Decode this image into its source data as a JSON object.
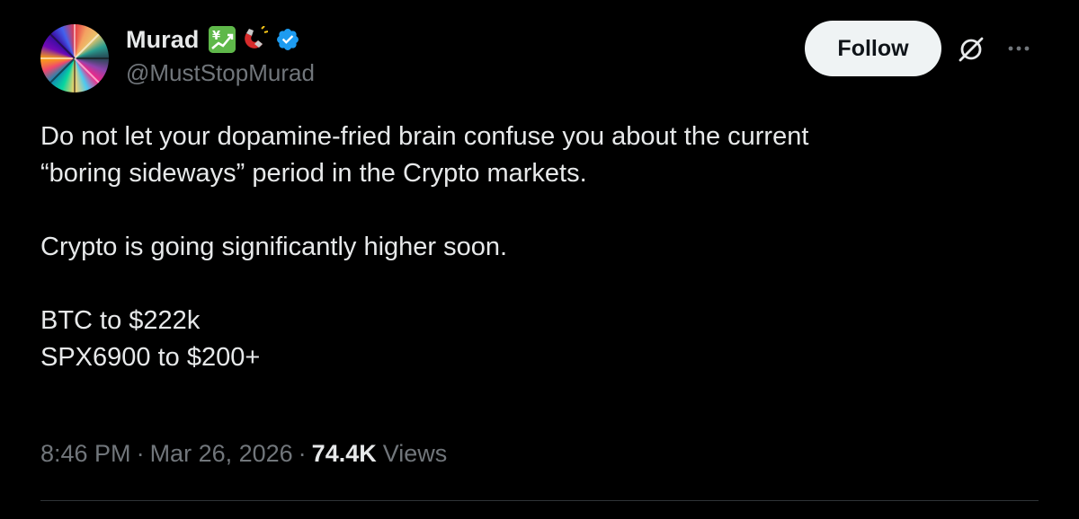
{
  "author": {
    "display_name": "Murad",
    "handle": "@MustStopMurad",
    "emojis": [
      "chart-increasing-with-yen-icon",
      "magnet-icon"
    ],
    "verified": true
  },
  "actions": {
    "follow_label": "Follow",
    "grok_icon": "grok-icon",
    "more_icon": "more-icon"
  },
  "tweet": {
    "lines": [
      "Do not let your dopamine-fried brain confuse you about the current",
      "“boring sideways” period in the Crypto markets.",
      "Crypto is going significantly higher soon.",
      "BTC to $222k",
      "SPX6900 to $200+"
    ]
  },
  "meta": {
    "time": "8:46 PM",
    "separator": "·",
    "date": "Mar 26, 2026",
    "views_count": "74.4K",
    "views_label": "Views"
  },
  "colors": {
    "background": "#000000",
    "text": "#e7e9ea",
    "secondary": "#71767b",
    "verified": "#1d9bf0",
    "follow_bg": "#eff3f4",
    "divider": "#2f3336"
  }
}
